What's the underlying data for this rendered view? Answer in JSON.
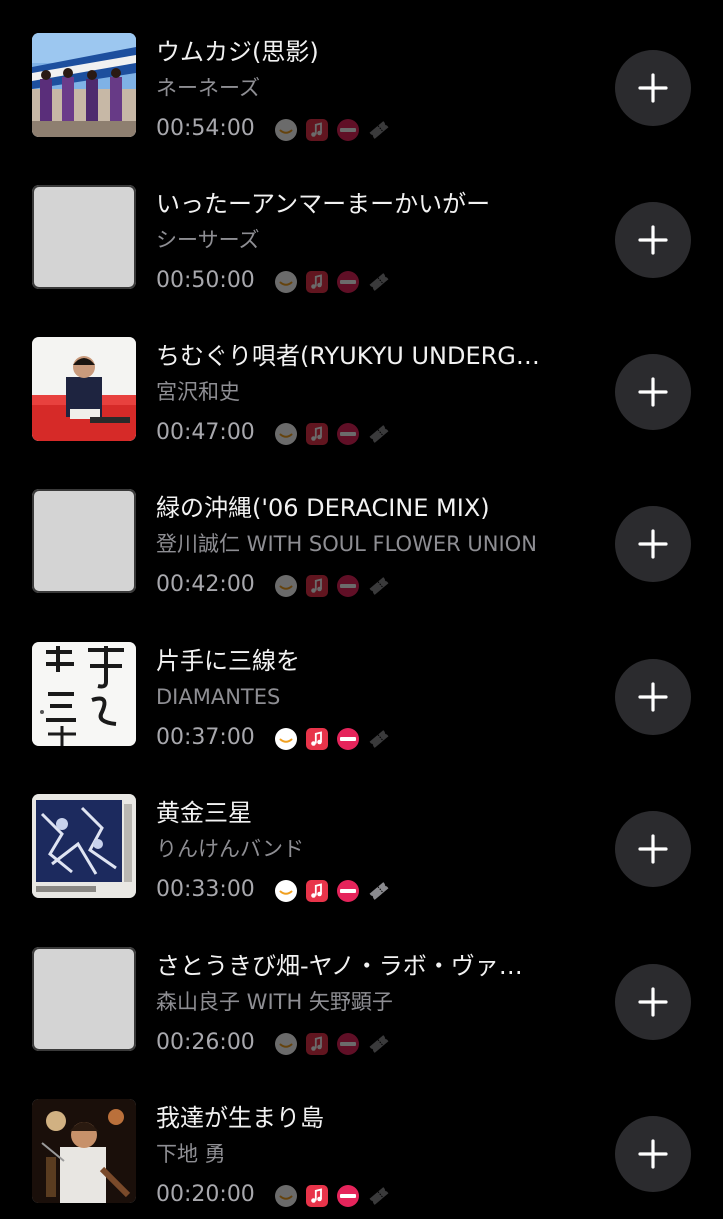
{
  "colors": {
    "background": "#000000",
    "title": "#f2f2f2",
    "subtitle": "#8e8e93",
    "add_button_bg": "#2b2b2e",
    "amazon_music": "#ffffff",
    "apple_music": "#e8344a",
    "recochoku": "#e5245b",
    "ticket": "#8a8a8e"
  },
  "tracks": [
    {
      "title": "ウムカジ(思影)",
      "artist": "ネーネーズ",
      "duration": "00:54:00",
      "artwork": "photo",
      "services_active": false,
      "add_icon": "plus-icon"
    },
    {
      "title": "いったーアンマーまーかいがー",
      "artist": "シーサーズ",
      "duration": "00:50:00",
      "artwork": "placeholder",
      "services_active": false,
      "add_icon": "plus-icon"
    },
    {
      "title": "ちむぐり唄者(RYUKYU UNDERG…",
      "artist": "宮沢和史",
      "duration": "00:47:00",
      "artwork": "photo",
      "services_active": false,
      "add_icon": "plus-icon"
    },
    {
      "title": "緑の沖縄('06 DERACINE MIX)",
      "artist": "登川誠仁 WITH SOUL FLOWER UNION",
      "duration": "00:42:00",
      "artwork": "placeholder",
      "services_active": false,
      "add_icon": "plus-icon"
    },
    {
      "title": "片手に三線を",
      "artist": "DIAMANTES",
      "duration": "00:37:00",
      "artwork": "calligraphy",
      "services_active": true,
      "add_icon": "plus-icon"
    },
    {
      "title": "黄金三星",
      "artist": "りんけんバンド",
      "duration": "00:33:00",
      "artwork": "photo",
      "services_active": true,
      "add_icon": "plus-icon"
    },
    {
      "title": "さとうきび畑-ヤノ・ラボ・ヴァ…",
      "artist": "森山良子 WITH 矢野顕子",
      "duration": "00:26:00",
      "artwork": "placeholder",
      "services_active": false,
      "add_icon": "plus-icon"
    },
    {
      "title": "我達が生まり島",
      "artist": "下地 勇",
      "duration": "00:20:00",
      "artwork": "photo",
      "services_active": false,
      "add_icon": "plus-icon"
    }
  ],
  "service_icons": [
    "amazon-music-icon",
    "apple-music-icon",
    "recochoku-icon",
    "ticket-icon"
  ]
}
